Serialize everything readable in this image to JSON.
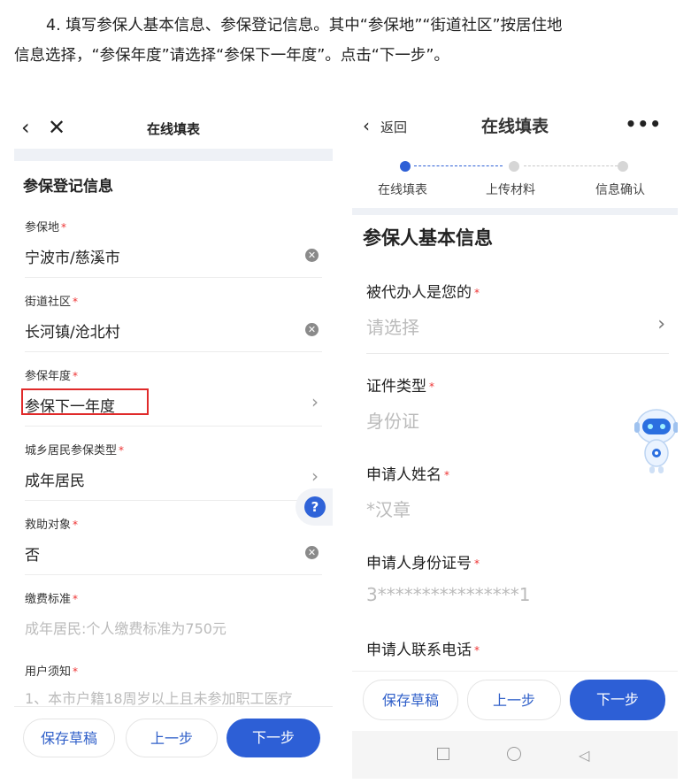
{
  "instructions": {
    "line1": "4. 填写参保人基本信息、参保登记信息。其中“参保地”“街道社区”按居住地",
    "line2": "信息选择，“参保年度”请选择“参保下一年度”。点击“下一步”。"
  },
  "left_screen": {
    "nav": {
      "back_icon": "‹",
      "close_icon": "✕",
      "title": "在线填表"
    },
    "section_title": "参保登记信息",
    "fields": [
      {
        "label": "参保地",
        "value": "宁波市/慈溪市",
        "control": "clear-icon"
      },
      {
        "label": "街道社区",
        "value": "长河镇/沧北村",
        "control": "clear-icon"
      },
      {
        "label": "参保年度",
        "value": "参保下一年度",
        "control": "chevron-right-icon",
        "highlight_color": "#e02a2a"
      },
      {
        "label": "城乡居民参保类型",
        "value": "成年居民",
        "control": "chevron-right-icon"
      },
      {
        "label": "救助对象",
        "value": "否",
        "control": "clear-icon"
      },
      {
        "label": "缴费标准",
        "value": "成年居民:个人缴费标准为750元"
      },
      {
        "label": "用户须知",
        "value": "1、本市户籍18周岁以上且未参加职工医疗"
      }
    ],
    "required_mark": "*",
    "help_icon": "?",
    "buttons": {
      "save": "保存草稿",
      "prev": "上一步",
      "next": "下一步"
    }
  },
  "right_screen": {
    "nav": {
      "back_icon": "‹",
      "back_label": "返回",
      "title": "在线填表",
      "more_icon": "•••"
    },
    "steps": [
      {
        "label": "在线填表",
        "active": true
      },
      {
        "label": "上传材料",
        "active": false
      },
      {
        "label": "信息确认",
        "active": false
      }
    ],
    "section_title": "参保人基本信息",
    "fields": [
      {
        "label": "被代办人是您的",
        "value": "请选择",
        "control": "chevron-right-icon"
      },
      {
        "label": "证件类型",
        "value": "身份证"
      },
      {
        "label": "申请人姓名",
        "value": "*汉章"
      },
      {
        "label": "申请人身份证号",
        "value": "3****************1"
      },
      {
        "label": "申请人联系电话",
        "value": ""
      }
    ],
    "required_mark": "*",
    "buttons": {
      "save": "保存草稿",
      "prev": "上一步",
      "next": "下一步"
    },
    "system_nav": [
      "square-icon",
      "circle-icon",
      "triangle-back-icon"
    ]
  },
  "colors": {
    "primary": "#2d5fd6",
    "highlight": "#e02a2a",
    "required": "#e33333",
    "band": "#eef1f6"
  }
}
